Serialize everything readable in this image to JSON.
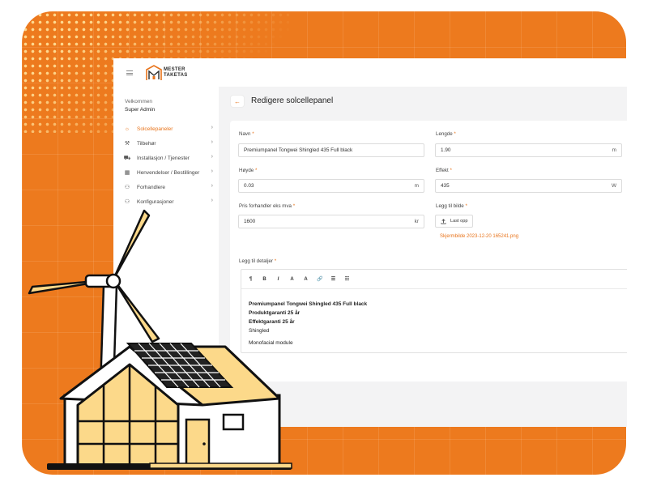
{
  "brand": {
    "logo_line1": "MESTER",
    "logo_line2": "TAKETAS"
  },
  "user": {
    "welcome": "Velkommen",
    "role": "Super Admin"
  },
  "sidebar": {
    "items": [
      {
        "label": "Solcellepaneler",
        "icon": "solar-sun-icon",
        "active": true
      },
      {
        "label": "Tilbehør",
        "icon": "wrench-icon",
        "active": false
      },
      {
        "label": "Installasjon / Tjenester",
        "icon": "truck-icon",
        "active": false
      },
      {
        "label": "Henvendelser / Bestillinger",
        "icon": "calendar-icon",
        "active": false
      },
      {
        "label": "Forhandlere",
        "icon": "users-icon",
        "active": false
      },
      {
        "label": "Konfigurasjoner",
        "icon": "users-gear-icon",
        "active": false
      }
    ]
  },
  "page": {
    "title": "Redigere solcellepanel",
    "back_icon": "arrow-left-icon"
  },
  "form": {
    "navn": {
      "label": "Navn",
      "value": "Premiumpanel Tongwei Shingled 435 Full black"
    },
    "lengde": {
      "label": "Lengde",
      "value": "1.90",
      "unit": "m"
    },
    "hoyde": {
      "label": "Høyde",
      "value": "0.03",
      "unit": "m"
    },
    "effekt": {
      "label": "Effekt",
      "value": "435",
      "unit": "W"
    },
    "pris": {
      "label": "Pris forhandler eks mva",
      "value": "1600",
      "unit": "kr"
    },
    "bilde": {
      "label": "Legg til bilde",
      "button": "Last opp",
      "file": "Skjermbilde 2023-12-20 165241.png"
    },
    "detaljer": {
      "label": "Legg til detaljer",
      "toolbar": [
        "¶",
        "B",
        "I",
        "A",
        "A",
        "🔗",
        "☰",
        "☷"
      ],
      "lines": [
        {
          "text": "Premiumpanel Tongwei Shingled 435 Full black",
          "bold": true
        },
        {
          "text": "Produktgaranti 25 år",
          "bold": true
        },
        {
          "text": "Effektgaranti 25 år",
          "bold": true
        },
        {
          "text": "Shingled",
          "bold": false
        },
        {
          "text": "Monofacial module",
          "bold": false
        }
      ]
    }
  },
  "required_mark": "*",
  "colors": {
    "accent": "#e8731a",
    "background_orange": "#ed7a1e",
    "house_yellow": "#fcd98a"
  }
}
